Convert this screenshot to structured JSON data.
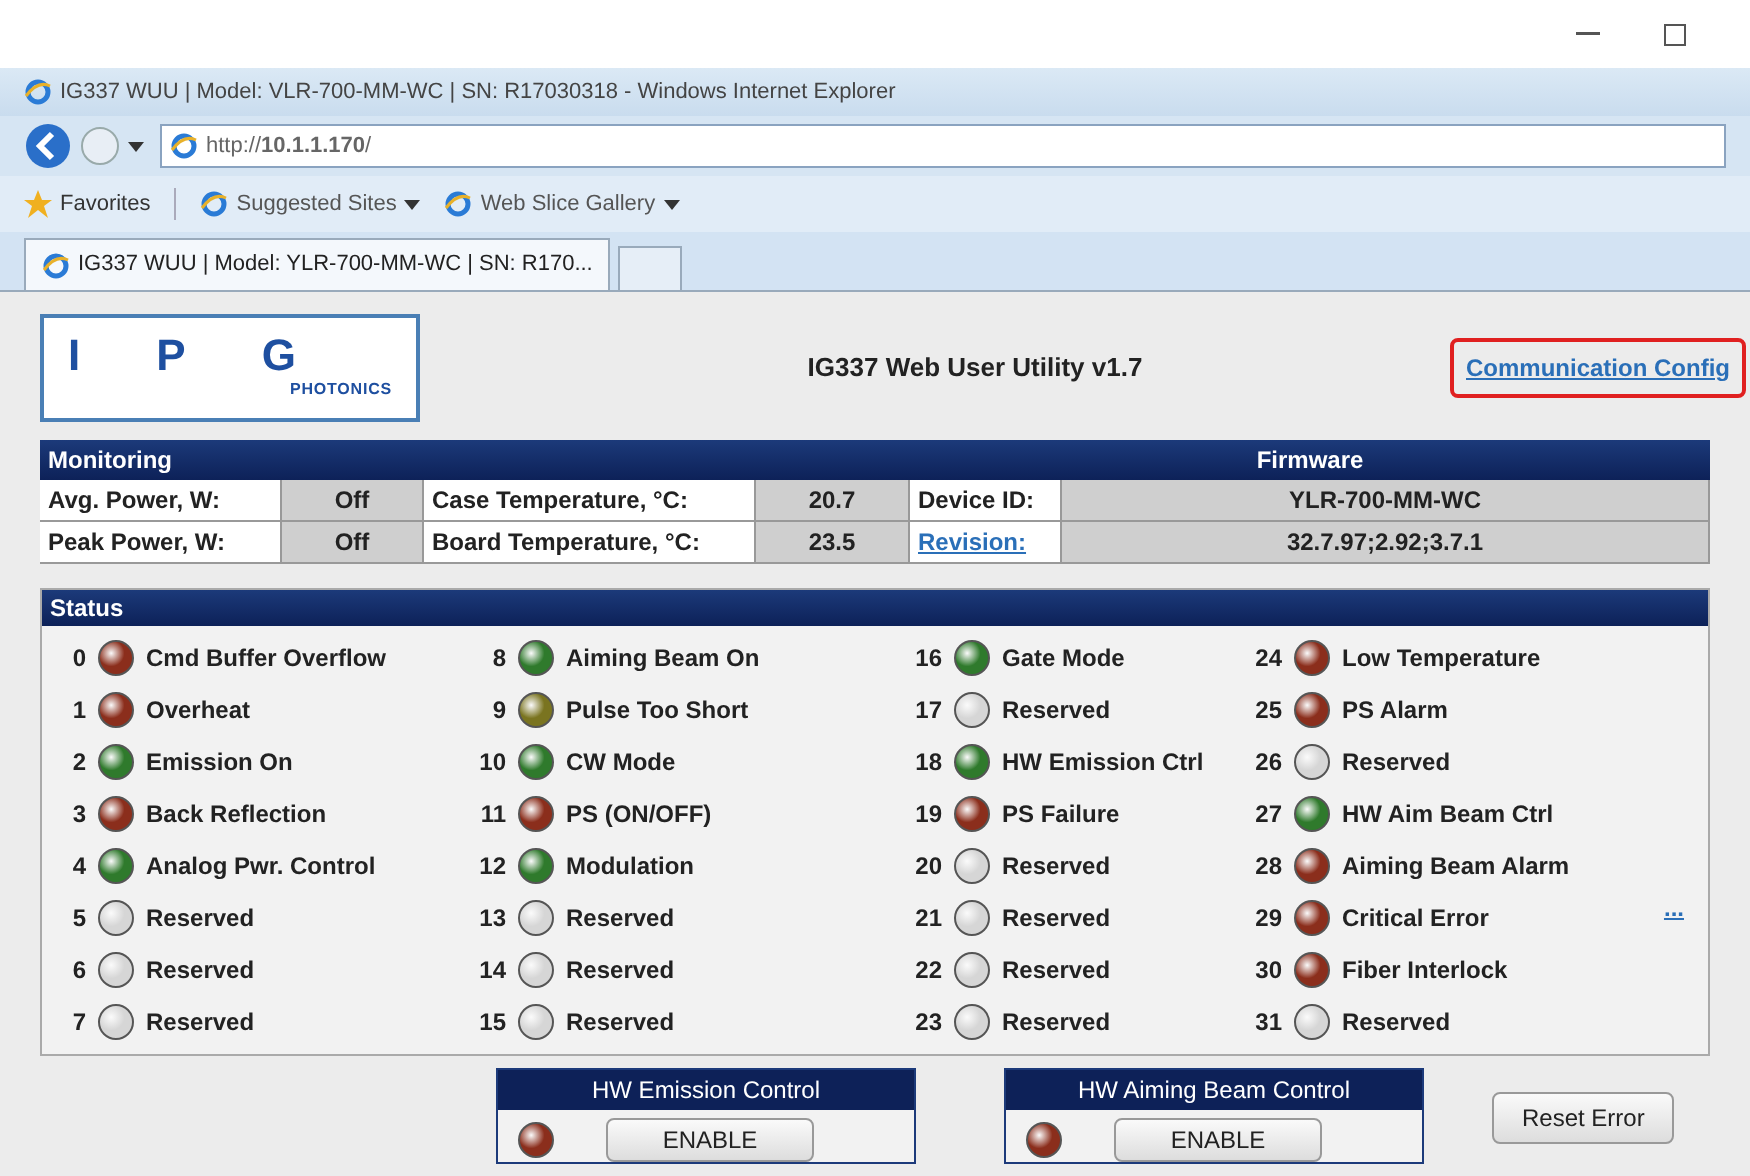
{
  "window": {
    "title": "IG337 WUU | Model: VLR-700-MM-WC | SN: R17030318 - Windows Internet Explorer"
  },
  "address_bar": {
    "value": "http://**10.1.1.170**/"
  },
  "favorites_bar": {
    "items": [
      {
        "label": "Favorites",
        "kind": "favorites"
      },
      {
        "label": "Suggested Sites",
        "kind": "dropdown"
      },
      {
        "label": "Web Slice Gallery",
        "kind": "dropdown"
      }
    ]
  },
  "tabs": [
    {
      "label": "IG337 WUU | Model: YLR-700-MM-WC | SN: R170...",
      "selected": true
    }
  ],
  "header": {
    "logo_text": "PHOTONICS",
    "logo_letters": [
      "I",
      "P",
      "G"
    ],
    "title": "IG337 Web User Utility v1.7",
    "link": "Communication Config"
  },
  "monitoring": {
    "title": "Monitoring",
    "rows": [
      {
        "label": "Avg. Power, W:",
        "value": "Off",
        "temp_label": "Case Temperature, °C:",
        "temp_value": "20.7"
      },
      {
        "label": "Peak Power, W:",
        "value": "Off",
        "temp_label": "Board Temperature, °C:",
        "temp_value": "23.5"
      }
    ]
  },
  "firmware": {
    "title": "Firmware",
    "rows": [
      {
        "label": "Device ID:",
        "value": "YLR-700-MM-WC",
        "link": false
      },
      {
        "label": "Revision:",
        "value": "32.7.97;2.92;3.7.1",
        "link": true
      }
    ]
  },
  "status": {
    "title": "Status",
    "more_link": "...",
    "items": [
      {
        "number": "0",
        "label": "Cmd Buffer Overflow",
        "color": "#8b2e1c"
      },
      {
        "number": "1",
        "label": "Overheat",
        "color": "#8b2e1c"
      },
      {
        "number": "2",
        "label": "Emission On",
        "color": "#2f7a2c"
      },
      {
        "number": "3",
        "label": "Back Reflection",
        "color": "#8b2e1c"
      },
      {
        "number": "4",
        "label": "Analog Pwr. Control",
        "color": "#2f7a2c"
      },
      {
        "number": "5",
        "label": "Reserved",
        "color": "#d6d6d6"
      },
      {
        "number": "6",
        "label": "Reserved",
        "color": "#d6d6d6"
      },
      {
        "number": "7",
        "label": "Reserved",
        "color": "#d6d6d6"
      },
      {
        "number": "8",
        "label": "Aiming Beam On",
        "color": "#2f7a2c"
      },
      {
        "number": "9",
        "label": "Pulse Too Short",
        "color": "#7a7420"
      },
      {
        "number": "10",
        "label": "CW Mode",
        "color": "#2f7a2c"
      },
      {
        "number": "11",
        "label": "PS (ON/OFF)",
        "color": "#8b2e1c"
      },
      {
        "number": "12",
        "label": "Modulation",
        "color": "#2f7a2c"
      },
      {
        "number": "13",
        "label": "Reserved",
        "color": "#d6d6d6"
      },
      {
        "number": "14",
        "label": "Reserved",
        "color": "#d6d6d6"
      },
      {
        "number": "15",
        "label": "Reserved",
        "color": "#d6d6d6"
      },
      {
        "number": "16",
        "label": "Gate Mode",
        "color": "#2f7a2c"
      },
      {
        "number": "17",
        "label": "Reserved",
        "color": "#d6d6d6"
      },
      {
        "number": "18",
        "label": "HW Emission Ctrl",
        "color": "#2f7a2c"
      },
      {
        "number": "19",
        "label": "PS Failure",
        "color": "#8b2e1c"
      },
      {
        "number": "20",
        "label": "Reserved",
        "color": "#d6d6d6"
      },
      {
        "number": "21",
        "label": "Reserved",
        "color": "#d6d6d6"
      },
      {
        "number": "22",
        "label": "Reserved",
        "color": "#d6d6d6"
      },
      {
        "number": "23",
        "label": "Reserved",
        "color": "#d6d6d6"
      },
      {
        "number": "24",
        "label": "Low Temperature",
        "color": "#8b2e1c"
      },
      {
        "number": "25",
        "label": "PS Alarm",
        "color": "#8b2e1c"
      },
      {
        "number": "26",
        "label": "Reserved",
        "color": "#d6d6d6"
      },
      {
        "number": "27",
        "label": "HW Aim Beam Ctrl",
        "color": "#2f7a2c"
      },
      {
        "number": "28",
        "label": "Aiming Beam Alarm",
        "color": "#8b2e1c"
      },
      {
        "number": "29",
        "label": "Critical Error",
        "color": "#8b2e1c"
      },
      {
        "number": "30",
        "label": "Fiber Interlock",
        "color": "#8b2e1c"
      },
      {
        "number": "31",
        "label": "Reserved",
        "color": "#d6d6d6"
      }
    ]
  },
  "controls": [
    {
      "title": "HW Emission Control",
      "button": "ENABLE",
      "color": "#8b2e1c"
    },
    {
      "title": "HW Aiming Beam Control",
      "button": "ENABLE",
      "color": "#8b2e1c"
    }
  ],
  "reset_button": "Reset Error"
}
